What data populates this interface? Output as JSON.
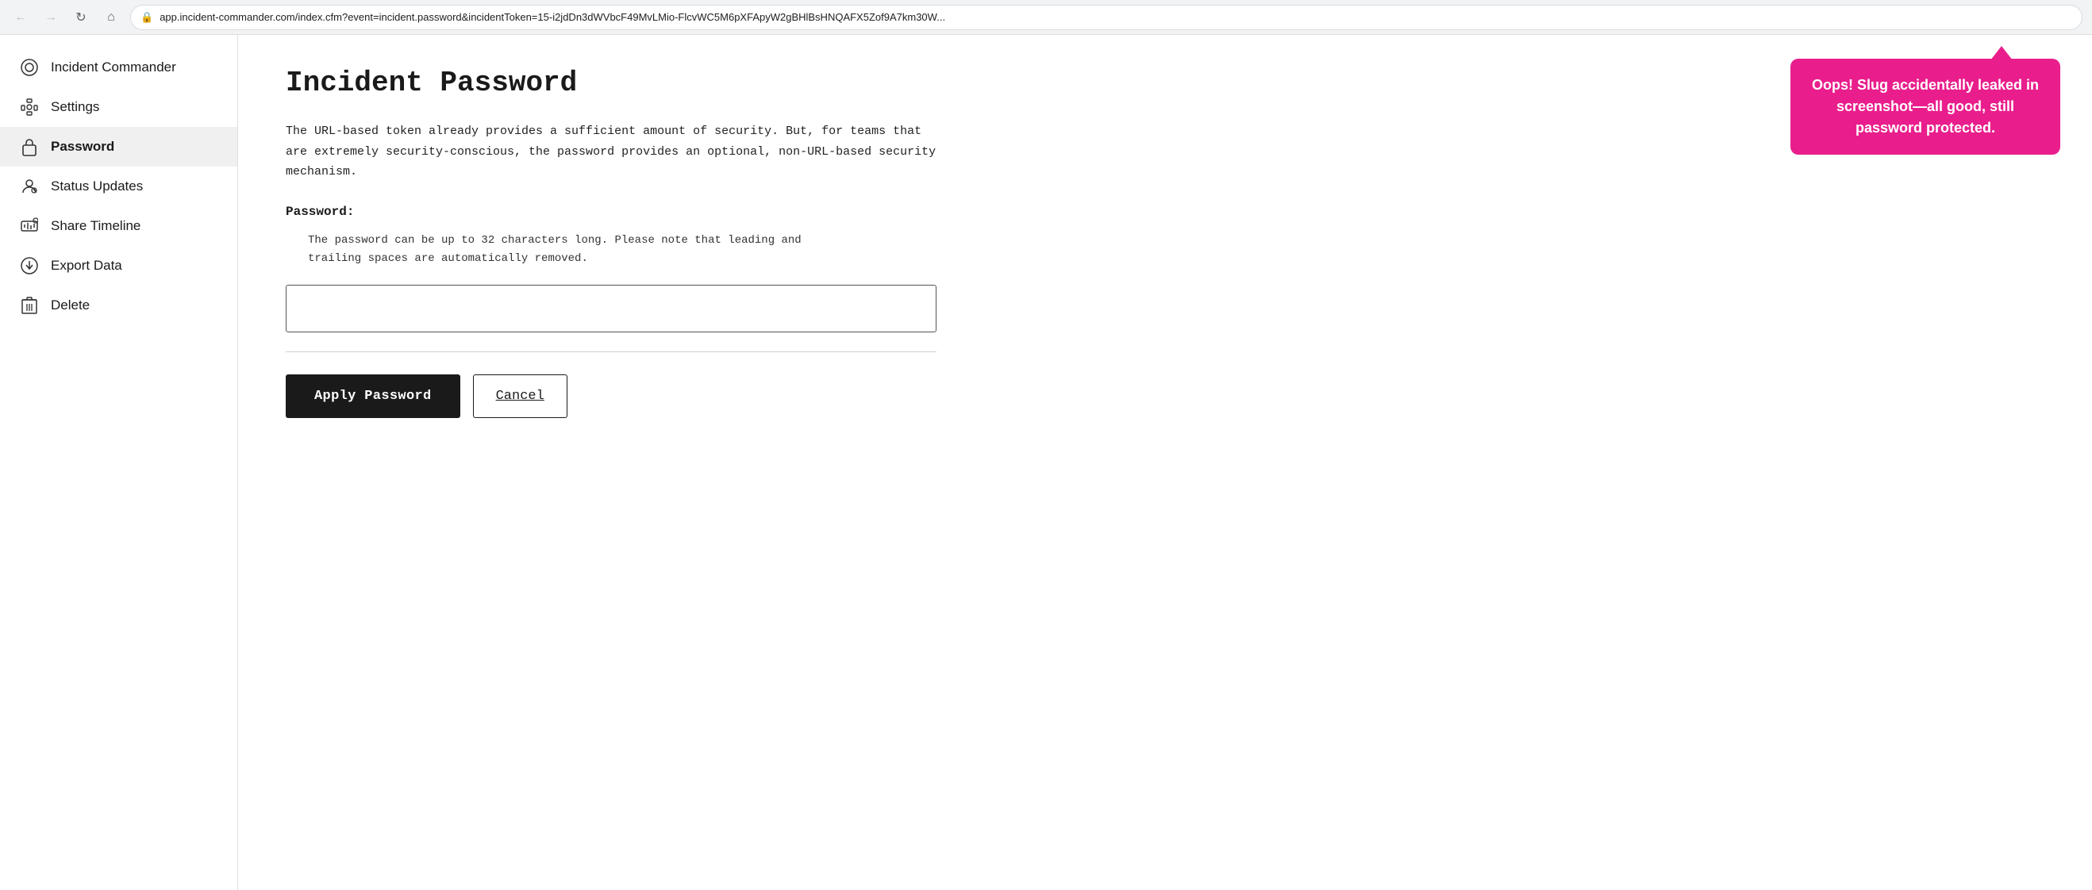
{
  "browser": {
    "url": "app.incident-commander.com/index.cfm?event=incident.password&incidentToken=15-i2jdDn3dWVbcF49MvLMio-FlcvWC5M6pXFApyW2gBHlBsHNQAFX5Zof9A7km30W...",
    "lock_icon": "🔒"
  },
  "sidebar": {
    "items": [
      {
        "id": "incident-commander",
        "label": "Incident Commander",
        "icon": "shield"
      },
      {
        "id": "settings",
        "label": "Settings",
        "icon": "settings"
      },
      {
        "id": "password",
        "label": "Password",
        "icon": "lock",
        "active": true
      },
      {
        "id": "status-updates",
        "label": "Status Updates",
        "icon": "status"
      },
      {
        "id": "share-timeline",
        "label": "Share Timeline",
        "icon": "timeline"
      },
      {
        "id": "export-data",
        "label": "Export Data",
        "icon": "export"
      },
      {
        "id": "delete",
        "label": "Delete",
        "icon": "delete"
      }
    ]
  },
  "main": {
    "title": "Incident Password",
    "description": "The URL-based token already provides a sufficient amount of security. But, for teams that are extremely security-conscious, the password provides an optional, non-URL-based security mechanism.",
    "password_label": "Password:",
    "password_hint_line1": "The password can be up to 32 characters long. Please note that leading and",
    "password_hint_line2": "trailing spaces are automatically removed.",
    "password_placeholder": "",
    "apply_button_label": "Apply Password",
    "cancel_button_label": "Cancel"
  },
  "tooltip": {
    "text": "Oops! Slug accidentally leaked in screenshot—all good, still password protected."
  },
  "icons": {
    "shield": "⊕",
    "settings": "⚙",
    "lock": "🔒",
    "status": "👤",
    "timeline": "📊",
    "export": "⬇",
    "delete": "🗑",
    "lock_small": "🔒",
    "arrow_back": "←",
    "arrow_forward": "→",
    "reload": "↻",
    "home": "⌂"
  }
}
